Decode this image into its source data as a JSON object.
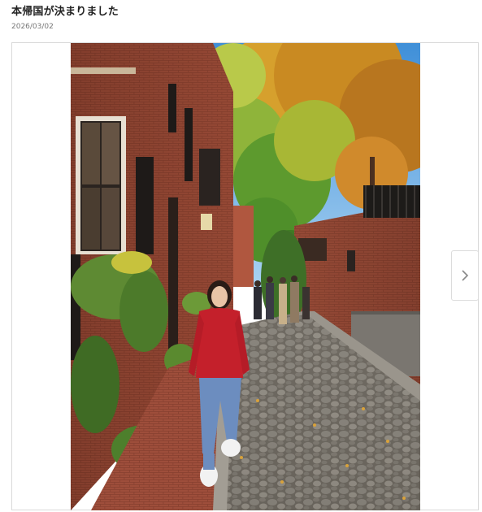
{
  "post": {
    "title": "本帰国が決まりました",
    "date": "2026/03/02"
  },
  "gallery": {
    "image_alt": "Woman in red sweater standing on a cobblestone alley lined with brick houses and autumn trees",
    "next_icon": "chevron-right-icon"
  },
  "colors": {
    "brick": "#8a3f2c",
    "sky": "#4c97dc",
    "sweater": "#c4202b",
    "jeans": "#6c8dbf",
    "foliage": "#d59a2a"
  }
}
